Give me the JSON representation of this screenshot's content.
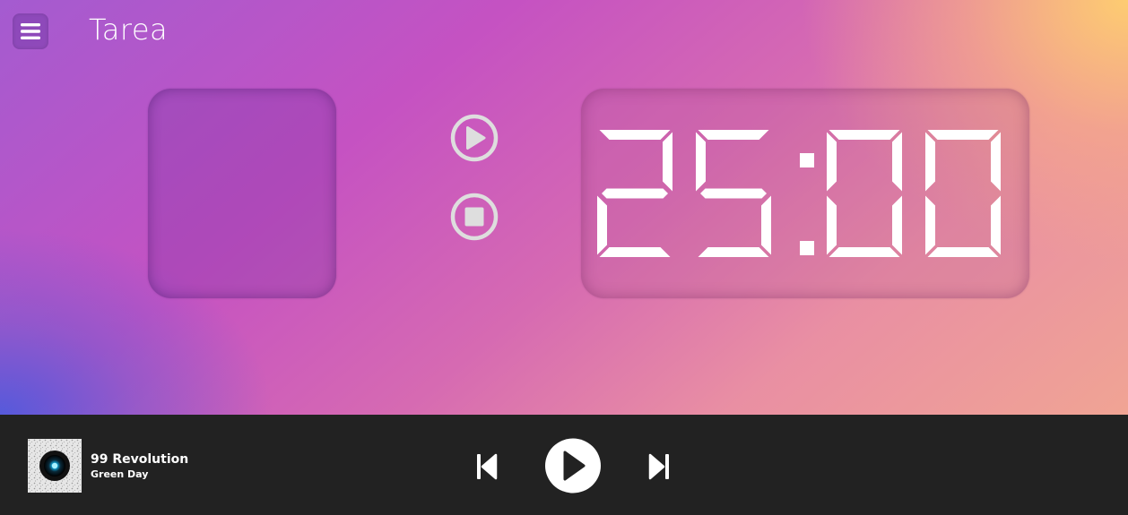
{
  "header": {
    "title": "Tarea",
    "menu_icon": "hamburger-menu-icon"
  },
  "task": {
    "name": ""
  },
  "controls": {
    "play_icon": "play-circle-icon",
    "stop_icon": "stop-circle-icon"
  },
  "timer": {
    "display": "25:00"
  },
  "player": {
    "track_title": "99 Revolution",
    "artist": "Green Day",
    "album_art_icon": "album-art",
    "prev_icon": "skip-previous-icon",
    "play_icon": "play-icon",
    "next_icon": "skip-next-icon"
  },
  "colors": {
    "player_bg": "#222222",
    "text": "#ffffff",
    "control_gray": "#dedede"
  }
}
